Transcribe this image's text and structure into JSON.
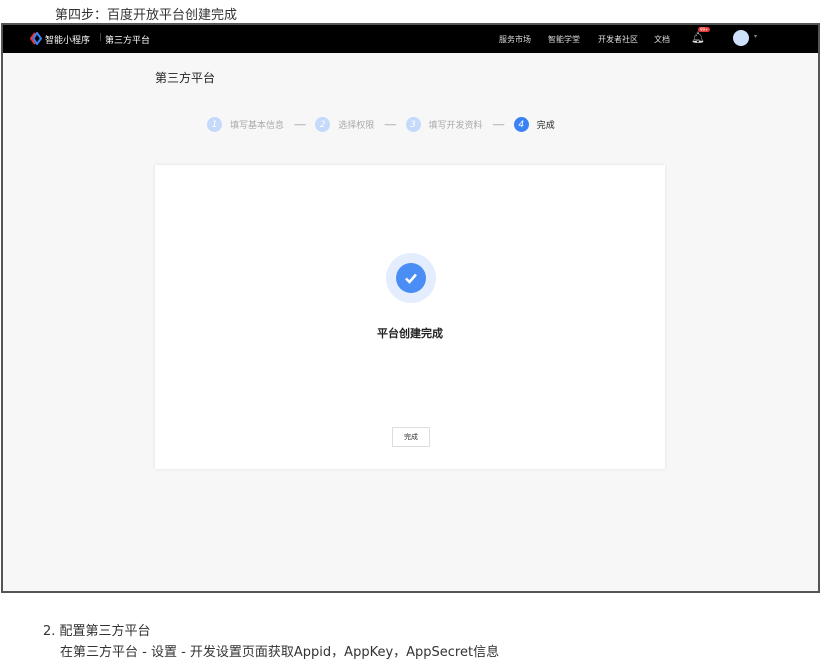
{
  "caption_top": "第四步：百度开放平台创建完成",
  "nav": {
    "brand": "智能小程序",
    "section": "第三方平台",
    "links": [
      "服务市场",
      "智能学堂",
      "开发者社区",
      "文档"
    ],
    "badge": "99+"
  },
  "page_title": "第三方平台",
  "steps": [
    {
      "num": "1",
      "label": "填写基本信息"
    },
    {
      "num": "2",
      "label": "选择权限"
    },
    {
      "num": "3",
      "label": "填写开发资料"
    },
    {
      "num": "4",
      "label": "完成"
    }
  ],
  "separator": "-----",
  "result": {
    "message": "平台创建完成",
    "button": "完成"
  },
  "caption_bottom": {
    "item": "2. 配置第三方平台",
    "desc": "在第三方平台 - 设置 - 开发设置页面获取Appid，AppKey，AppSecret信息"
  }
}
